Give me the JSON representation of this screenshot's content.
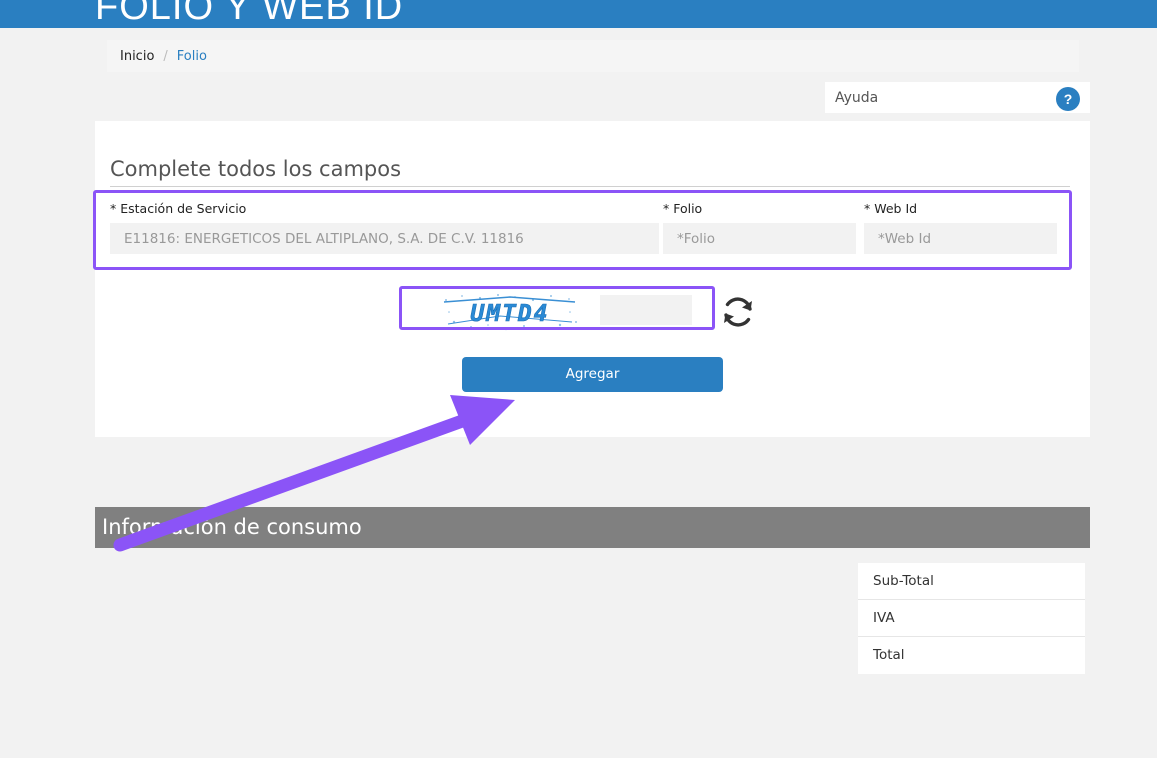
{
  "header": {
    "title": "FOLIO Y WEB ID"
  },
  "breadcrumb": {
    "home": "Inicio",
    "separator": "/",
    "current": "Folio"
  },
  "help": {
    "label": "Ayuda",
    "icon_text": "?"
  },
  "form": {
    "heading": "Complete todos los campos",
    "station_label": "* Estación de Servicio",
    "station_value": "E11816: ENERGETICOS DEL ALTIPLANO, S.A. DE C.V. 11816",
    "folio_label": "* Folio",
    "folio_placeholder": "*Folio",
    "webid_label": "* Web Id",
    "webid_placeholder": "*Web Id"
  },
  "captcha": {
    "text": "UMTD4",
    "icon": "refresh-icon"
  },
  "add_button": {
    "label": "Agregar"
  },
  "consumption": {
    "title": "Información de consumo",
    "rows": [
      "Sub-Total",
      "IVA",
      "Total"
    ]
  },
  "colors": {
    "primary": "#2a7fc1",
    "highlight": "#8b54f7",
    "section_bar": "#808080"
  }
}
